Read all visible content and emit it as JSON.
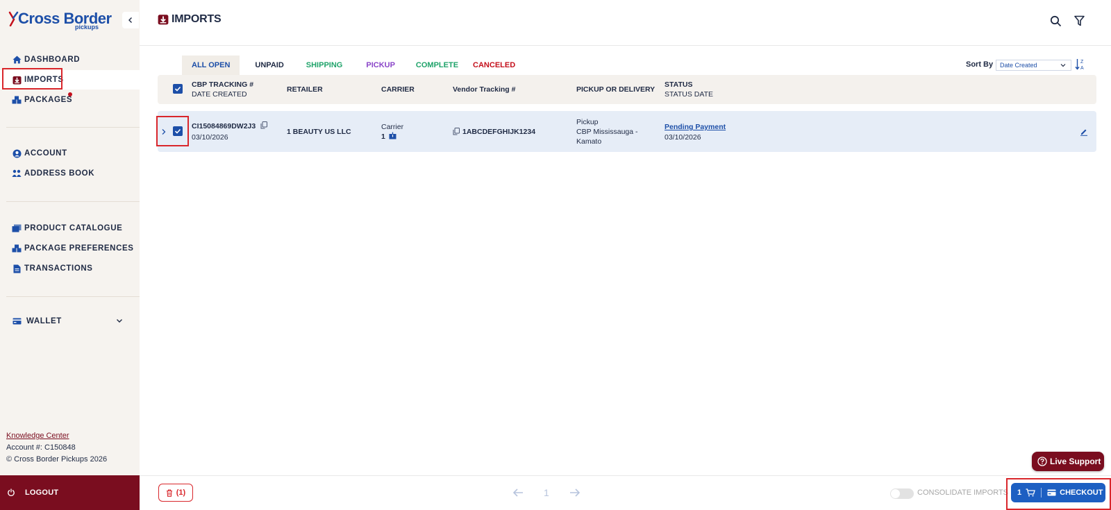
{
  "brand": {
    "name": "Cross Border",
    "sub": "pickups"
  },
  "sidebar": {
    "nav_main": [
      {
        "label": "DASHBOARD",
        "icon": "home-icon"
      },
      {
        "label": "IMPORTS",
        "icon": "imports-icon"
      },
      {
        "label": "PACKAGES",
        "icon": "packages-icon"
      }
    ],
    "nav_account": [
      {
        "label": "ACCOUNT",
        "icon": "user-icon"
      },
      {
        "label": "ADDRESS BOOK",
        "icon": "address-book-icon"
      }
    ],
    "nav_tools": [
      {
        "label": "PRODUCT CATALOGUE",
        "icon": "catalogue-icon"
      },
      {
        "label": "PACKAGE PREFERENCES",
        "icon": "preferences-icon"
      },
      {
        "label": "TRANSACTIONS",
        "icon": "document-icon"
      }
    ],
    "wallet": {
      "label": "WALLET",
      "icon": "wallet-icon"
    },
    "knowledge_center": "Knowledge Center",
    "account_number": "Account #: C150848",
    "copyright": "© Cross Border Pickups 2026",
    "logout": "LOGOUT"
  },
  "header": {
    "title": "IMPORTS"
  },
  "tabs": [
    {
      "label": "ALL OPEN",
      "color": "#1d4fa8"
    },
    {
      "label": "UNPAID",
      "color": "#1f2a44"
    },
    {
      "label": "SHIPPING",
      "color": "#1fa36a"
    },
    {
      "label": "PICKUP",
      "color": "#8a44c8"
    },
    {
      "label": "COMPLETE",
      "color": "#1fa36a"
    },
    {
      "label": "CANCELED",
      "color": "#c4101c"
    }
  ],
  "sort": {
    "label": "Sort By",
    "selected": "Date Created"
  },
  "table": {
    "headers": {
      "tracking": "CBP TRACKING #",
      "date_created": "DATE CREATED",
      "retailer": "RETAILER",
      "carrier": "CARRIER",
      "vendor_tracking": "Vendor Tracking #",
      "pickup_delivery": "PICKUP OR DELIVERY",
      "status": "STATUS",
      "status_date": "STATUS DATE"
    },
    "rows": [
      {
        "tracking": "CI15084869DW2J3",
        "date_created": "03/10/2026",
        "retailer": "1 BEAUTY US LLC",
        "carrier": "Carrier",
        "carrier_count": "1",
        "vendor_tracking": "1ABCDEFGHIJK1234",
        "pickup_type": "Pickup",
        "pickup_location_1": "CBP Mississauga -",
        "pickup_location_2": "Kamato",
        "status": "Pending Payment",
        "status_date": "03/10/2026"
      }
    ]
  },
  "footer": {
    "trash_count": "(1)",
    "page": "1",
    "consolidate": "CONSOLIDATE IMPORTS",
    "cart_count": "1",
    "checkout": "CHECKOUT"
  },
  "live_support": "Live Support",
  "colors": {
    "primary_blue": "#1d5fc2",
    "brand_maroon": "#7a0d1f",
    "highlight_red": "#d9262b"
  }
}
